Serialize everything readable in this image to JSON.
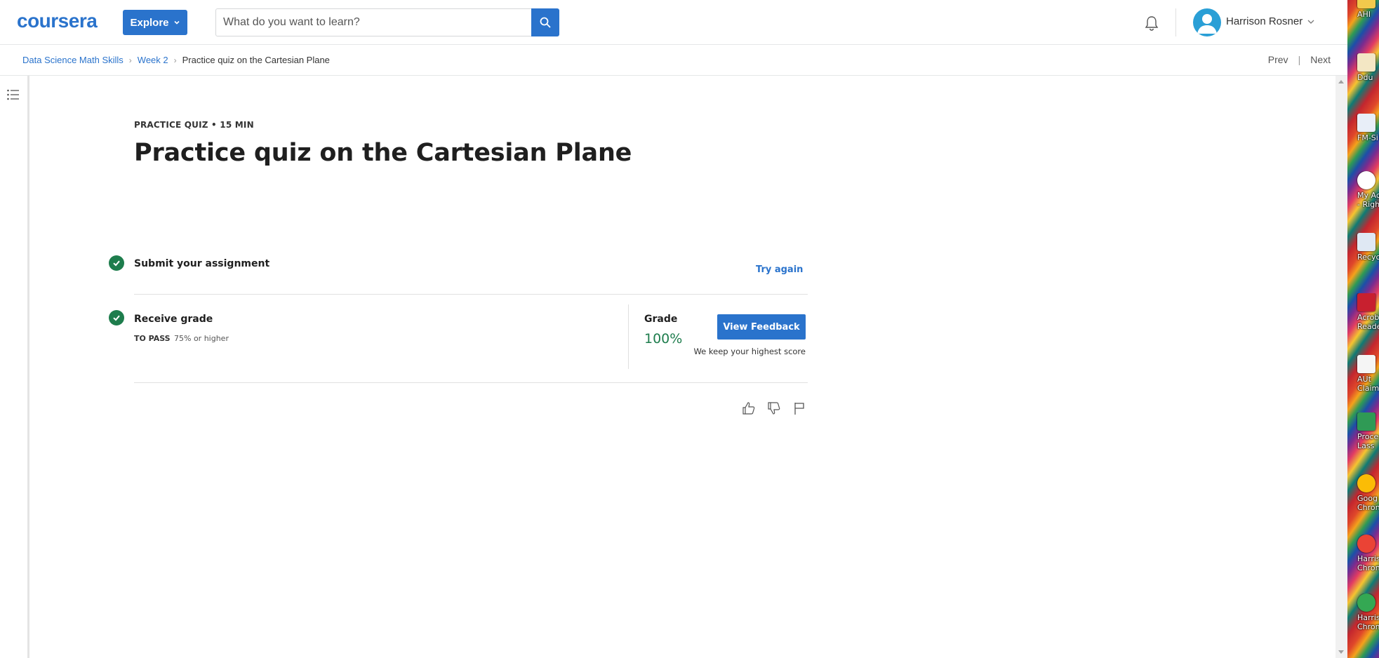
{
  "header": {
    "logo": "coursera",
    "explore_label": "Explore",
    "search_placeholder": "What do you want to learn?",
    "username": "Harrison Rosner"
  },
  "breadcrumb": {
    "items": [
      "Data Science Math Skills",
      "Week 2",
      "Practice quiz on the Cartesian Plane"
    ],
    "prev": "Prev",
    "separator": "|",
    "next": "Next"
  },
  "quiz": {
    "meta": "PRACTICE QUIZ • 15 MIN",
    "title": "Practice quiz on the Cartesian Plane"
  },
  "steps": {
    "submit": {
      "title": "Submit your assignment",
      "action": "Try again",
      "completed": true
    },
    "receive": {
      "title": "Receive grade",
      "pass_label": "TO PASS",
      "pass_value": "75% or higher",
      "grade_label": "Grade",
      "grade_value": "100%",
      "feedback_button": "View Feedback",
      "note": "We keep your highest score",
      "completed": true
    }
  },
  "reactions": [
    "thumbs-up-icon",
    "thumbs-down-icon",
    "flag-icon"
  ],
  "desktop_icons": [
    {
      "label": "AHI"
    },
    {
      "label": "Ddu"
    },
    {
      "label": "FM-Si"
    },
    {
      "label": "My Acc"
    },
    {
      "label": "- Right"
    },
    {
      "label": "Recycle"
    },
    {
      "label": "Acrob"
    },
    {
      "label": "Reade"
    },
    {
      "label": "AUt"
    },
    {
      "label": "Claim"
    },
    {
      "label": "Proce"
    },
    {
      "label": "Lass"
    },
    {
      "label": "Goog"
    },
    {
      "label": "Chron"
    },
    {
      "label": "Harris"
    },
    {
      "label": "Chron"
    },
    {
      "label": "Harris"
    },
    {
      "label": "Chrom"
    }
  ],
  "colors": {
    "brand_blue": "#2a73cc",
    "success_green": "#1e7d4d"
  }
}
